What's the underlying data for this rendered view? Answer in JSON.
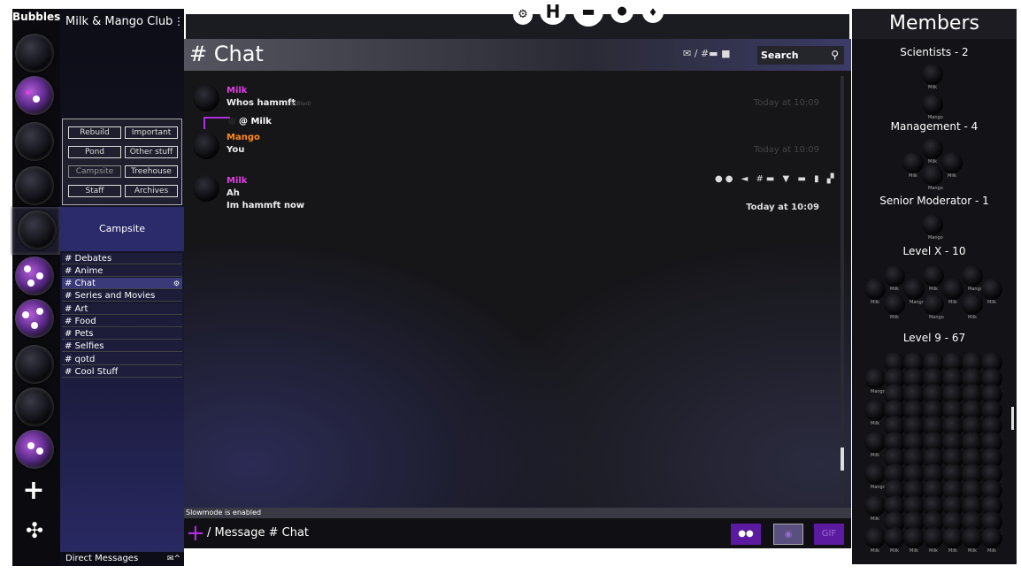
{
  "rail": {
    "title": "Bubbles"
  },
  "server": {
    "name": "Milk & Mango Club",
    "menu_icon": "⋮",
    "categories": [
      "Rebuild",
      "Important",
      "Pond",
      "Other stuff",
      "Campsite",
      "Treehouse",
      "Staff",
      "Archives"
    ],
    "current_category": "Campsite",
    "channels": [
      "# Debates",
      "# Anime",
      "# Chat",
      "# Series and Movies",
      "# Art",
      "# Food",
      "# Pets",
      "# Selfies",
      "# qotd",
      "# Cool Stuff"
    ],
    "direct_messages": "Direct Messages"
  },
  "chat": {
    "title": "# Chat",
    "search_placeholder": "Search",
    "messages": [
      {
        "author": "Milk",
        "lines": [
          "Whos hammft"
        ],
        "edited": "(edited)",
        "time": "Today at 10:09"
      },
      {
        "reply_to": "@ Milk",
        "author": "Mango",
        "lines": [
          "You"
        ],
        "time": "Today at 10:09"
      },
      {
        "author": "Milk",
        "lines": [
          "Ah",
          "Im hammft now"
        ],
        "time": "Today at 10:09"
      }
    ],
    "slowmode": "Slowmode is enabled",
    "composer_placeholder": "/ Message # Chat",
    "gif_label": "GIF"
  },
  "members": {
    "title": "Members",
    "roles": [
      "Scientists - 2",
      "Management - 4",
      "Senior Moderator - 1",
      "Level X - 10",
      "Level 9 - 67"
    ],
    "milk_label": "Milk",
    "mango_label": "Mango"
  },
  "colors": {
    "milk": "#e23de6",
    "mango": "#ff8a1a",
    "accent": "#b12de0"
  }
}
